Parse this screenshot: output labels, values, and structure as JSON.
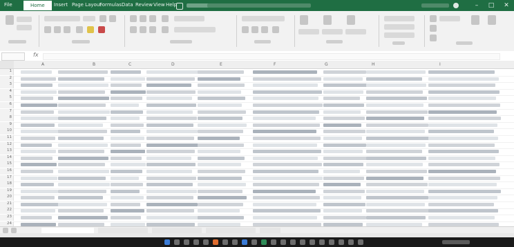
{
  "window": {
    "title": "",
    "controls": [
      "–",
      "□",
      "✕"
    ]
  },
  "ribbon": {
    "tabs": [
      "File",
      "Home",
      "Insert",
      "Page Layout",
      "Formulas",
      "Data",
      "Review",
      "View",
      "Help"
    ],
    "active_tab": "Home"
  },
  "sheet": {
    "column_headers": [
      "A",
      "B",
      "C",
      "D",
      "E",
      "F",
      "G",
      "H",
      "I"
    ],
    "row_numbers": [
      "1",
      "2",
      "3",
      "4",
      "5",
      "6",
      "7",
      "8",
      "9",
      "10",
      "11",
      "12",
      "13",
      "14",
      "15",
      "16",
      "17",
      "18",
      "19",
      "20",
      "21",
      "22",
      "23",
      "24"
    ]
  },
  "taskbar": {
    "time": "",
    "date": ""
  },
  "icons": {
    "close": "close-icon",
    "maximize": "maximize-icon",
    "minimize": "minimize-icon",
    "search": "search-icon",
    "start": "windows-start-icon"
  }
}
